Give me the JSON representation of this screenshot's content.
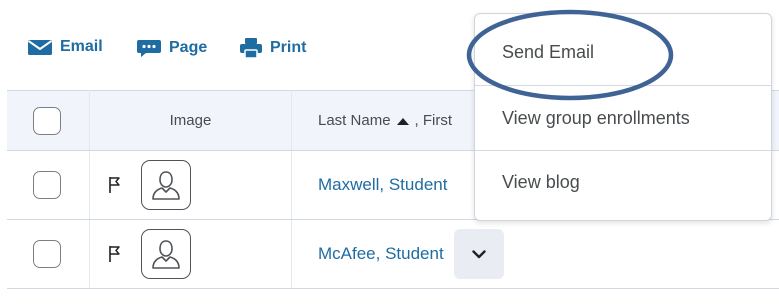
{
  "toolbar": {
    "email_label": "Email",
    "page_label": "Page",
    "print_label": "Print"
  },
  "table": {
    "headers": {
      "image": "Image",
      "last_name": "Last Name",
      "first_suffix": ", First"
    },
    "rows": [
      {
        "name": "Maxwell, Student"
      },
      {
        "name": "McAfee, Student"
      }
    ]
  },
  "menu": {
    "items": [
      {
        "label": "Send Email"
      },
      {
        "label": "View group enrollments"
      },
      {
        "label": "View blog"
      }
    ]
  },
  "colors": {
    "link": "#1f6ca3",
    "highlight_ring": "#3f6395"
  }
}
